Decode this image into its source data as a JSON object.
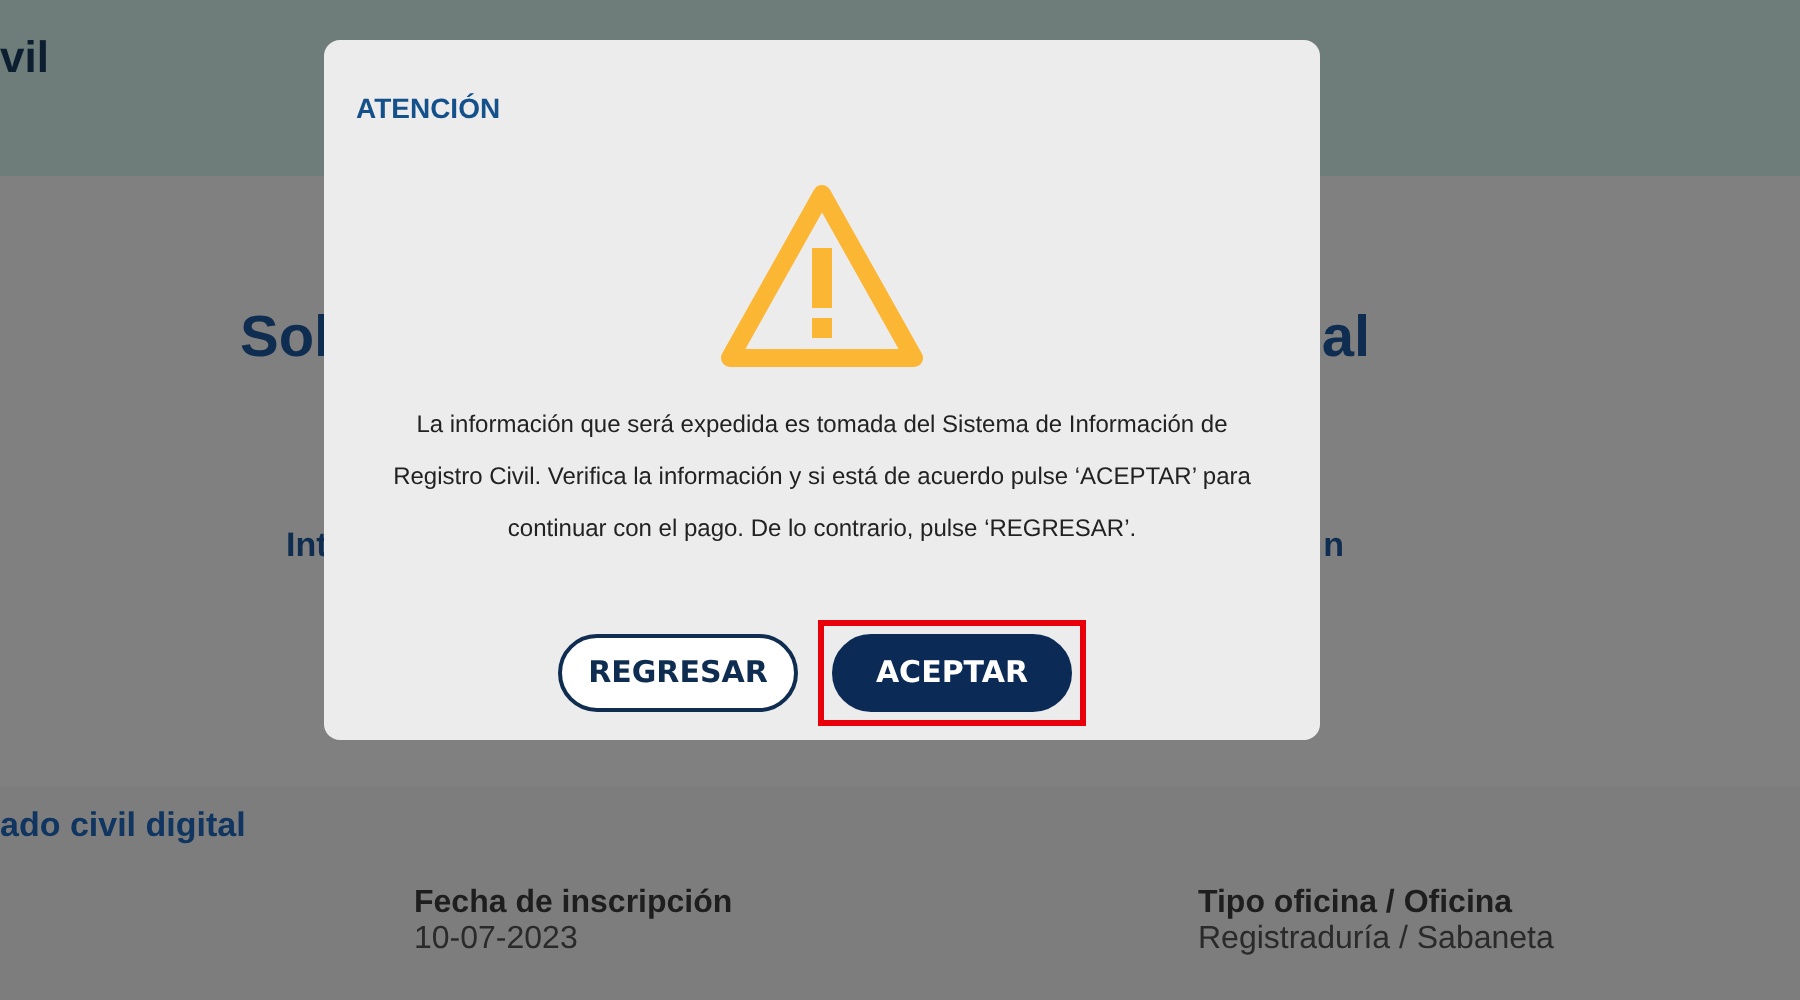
{
  "header": {
    "title": "vil"
  },
  "background": {
    "heading_parts": [
      "Sol",
      "al"
    ],
    "info_parts": [
      "Int",
      "n"
    ],
    "section_title": "ado civil digital",
    "fields": [
      {
        "label": "Fecha de inscripción",
        "value": "10-07-2023"
      },
      {
        "label": "Tipo oficina / Oficina",
        "value": "Registraduría / Sabaneta"
      }
    ]
  },
  "dialog": {
    "title": "ATENCIÓN",
    "message": "La información que será expedida es tomada del Sistema de Información de Registro Civil. Verifica la información y si está de acuerdo pulse ‘ACEPTAR’ para continuar con el pago. De lo contrario, pulse ‘REGRESAR’.",
    "buttons": [
      {
        "label": "REGRESAR",
        "kind": "outline",
        "highlighted": false
      },
      {
        "label": "ACEPTAR",
        "kind": "filled",
        "highlighted": true
      }
    ]
  }
}
